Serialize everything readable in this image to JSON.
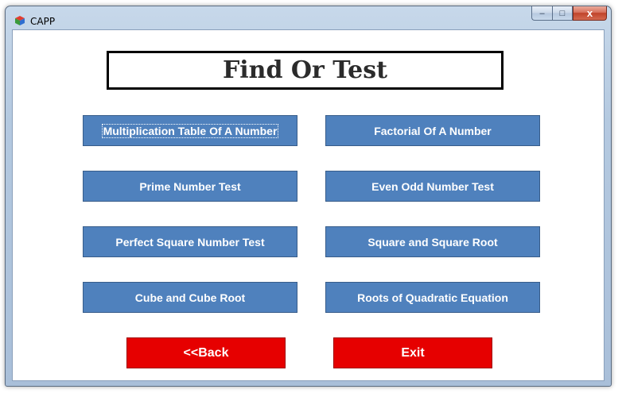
{
  "window": {
    "title": "CAPP",
    "controls": {
      "minimize": "–",
      "maximize": "□",
      "close": "x"
    }
  },
  "main": {
    "heading": "Find Or Test",
    "buttons": [
      {
        "label": "Multiplication Table Of A Number"
      },
      {
        "label": "Factorial Of A Number"
      },
      {
        "label": "Prime Number Test"
      },
      {
        "label": "Even Odd Number Test"
      },
      {
        "label": "Perfect Square Number Test"
      },
      {
        "label": "Square and Square Root"
      },
      {
        "label": "Cube and Cube Root"
      },
      {
        "label": "Roots of Quadratic Equation"
      }
    ],
    "back_label": "<<Back",
    "exit_label": "Exit"
  },
  "colors": {
    "button_blue": "#4f81bd",
    "button_red": "#e60000"
  }
}
